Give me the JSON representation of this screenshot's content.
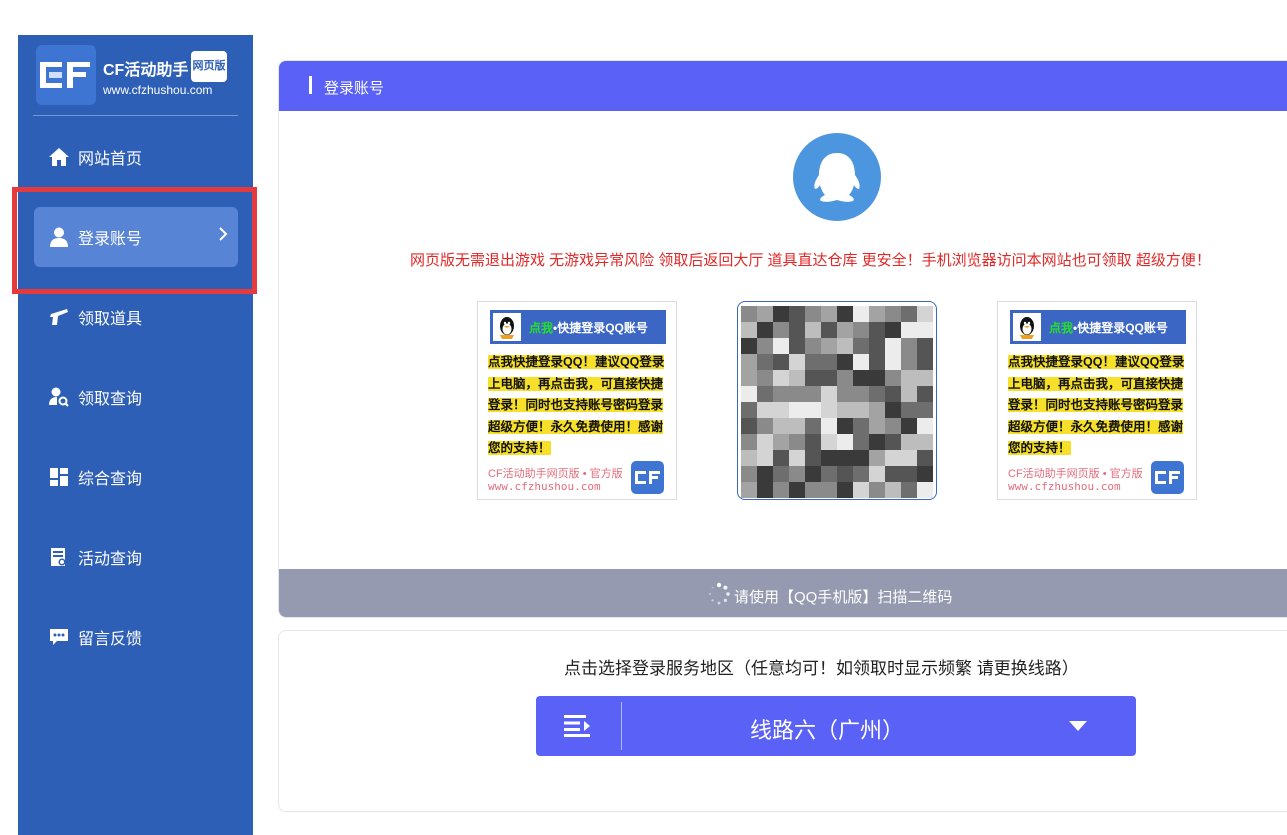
{
  "brand": {
    "name": "CF活动助手",
    "tag": "网页版",
    "url": "www.cfzhushou.com"
  },
  "sidebar": {
    "items": [
      {
        "label": "网站首页",
        "icon": "home-icon"
      },
      {
        "label": "登录账号",
        "icon": "user-icon",
        "active": true
      },
      {
        "label": "领取道具",
        "icon": "gun-icon"
      },
      {
        "label": "领取查询",
        "icon": "user-search-icon"
      },
      {
        "label": "综合查询",
        "icon": "dashboard-icon"
      },
      {
        "label": "活动查询",
        "icon": "calendar-icon"
      },
      {
        "label": "留言反馈",
        "icon": "message-icon"
      }
    ]
  },
  "login_panel": {
    "title": "登录账号",
    "notice": "网页版无需退出游戏 无游戏异常风险 领取后返回大厅 道具直达仓库 更安全！手机浏览器访问本网站也可领取 超级方便！",
    "promo": {
      "head_highlight": "点我",
      "head_text": "•快捷登录QQ账号",
      "body_lines": [
        "点我快捷登录QQ！建议QQ登录",
        "上电脑，再点击我，可直接快捷",
        "登录！同时也支持账号密码登录",
        "超级方便！永久免费使用！感谢",
        "您的支持！"
      ],
      "footer_line1": "CF活动助手网页版 • 官方版",
      "footer_line2": "www.cfzhushou.com"
    },
    "status": "请使用【QQ手机版】扫描二维码"
  },
  "server_panel": {
    "label": "点击选择登录服务地区（任意均可！如领取时显示频繁 请更换线路）",
    "selected": "线路六（广州）"
  },
  "colors": {
    "sidebar_bg": "#2e5fb6",
    "active_item": "#5884d6",
    "accent": "#5a61f7",
    "highlight_border": "#e53a3e",
    "notice_text": "#e12828",
    "status_bar": "#969ab1"
  }
}
